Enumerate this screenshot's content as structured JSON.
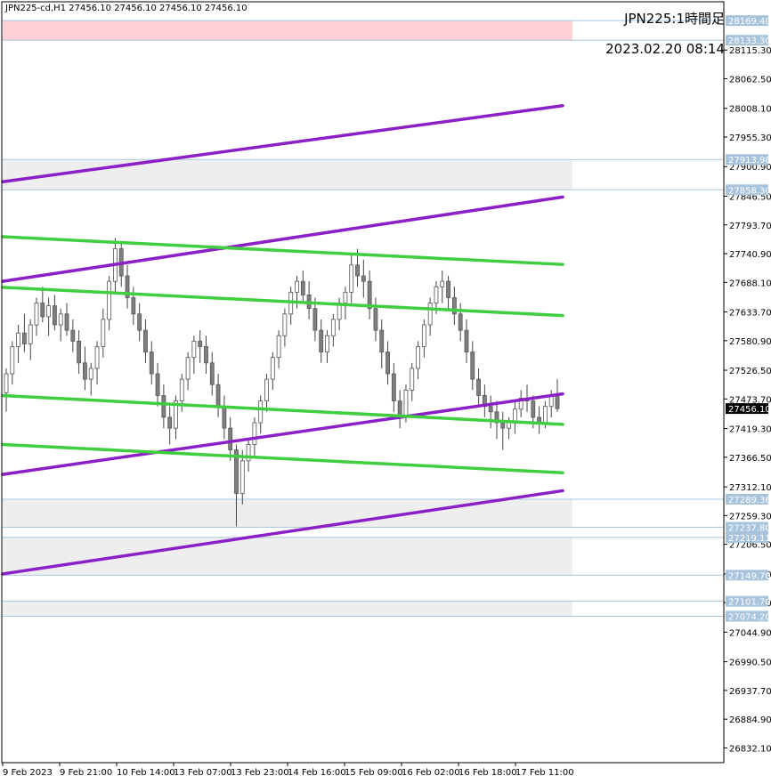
{
  "header": {
    "ohlc": "JPN225-cd,H1  27456.10 27456.10 27456.10 27456.10",
    "title": "JPN225:1時間足",
    "datetime": "2023.02.20 08:14"
  },
  "colors": {
    "purple": "#8b1fc8",
    "green": "#3fce3f",
    "zone_pink": "#ffd0d8",
    "zone_gray": "#eeeeee",
    "level_line": "#a8c8e0",
    "tag_bg": "#a8c3dc",
    "price_tag_bg": "#000000",
    "candle_up": "#ffffff",
    "candle_down": "#7f7f7f",
    "axis": "#000000"
  },
  "chart_data": {
    "type": "candlestick",
    "symbol": "JPN225-cd",
    "timeframe": "H1",
    "current_price": 27456.1,
    "current_price_label": "27456.10",
    "ylim": [
      26805,
      28204
    ],
    "y_ticks": [
      "28115.30",
      "28062.50",
      "28008.10",
      "27955.30",
      "27900.90",
      "27846.50",
      "27793.70",
      "27740.90",
      "27688.10",
      "27633.70",
      "27580.90",
      "27526.50",
      "27473.70",
      "27419.30",
      "27366.50",
      "27312.10",
      "27259.30",
      "27206.50",
      "27152.10",
      "27099.30",
      "27044.90",
      "26990.50",
      "26937.70",
      "26884.90",
      "26832.10"
    ],
    "x_labels": [
      "9 Feb 2023",
      "9 Feb 21:00",
      "10 Feb 14:00",
      "13 Feb 07:00",
      "13 Feb 23:00",
      "14 Feb 16:00",
      "15 Feb 09:00",
      "16 Feb 02:00",
      "16 Feb 18:00",
      "17 Feb 11:00"
    ],
    "levels": [
      {
        "label": "28169.40",
        "price": 28169.4
      },
      {
        "label": "28133.30",
        "price": 28133.3
      },
      {
        "label": "27913.98",
        "price": 27913.98
      },
      {
        "label": "27858.30",
        "price": 27858.3
      },
      {
        "label": "27289.36",
        "price": 27289.36
      },
      {
        "label": "27237.80",
        "price": 27237.8
      },
      {
        "label": "27219.11",
        "price": 27219.11
      },
      {
        "label": "27149.70",
        "price": 27149.7
      },
      {
        "label": "27101.70",
        "price": 27101.7
      },
      {
        "label": "27074.20",
        "price": 27074.2
      }
    ],
    "zones": [
      {
        "kind": "resistance",
        "from": 28133.3,
        "to": 28169.4
      },
      {
        "kind": "range",
        "from": 27858.3,
        "to": 27913.98
      },
      {
        "kind": "range",
        "from": 27237.8,
        "to": 27289.36
      },
      {
        "kind": "range",
        "from": 27149.7,
        "to": 27219.11
      },
      {
        "kind": "range",
        "from": 27074.2,
        "to": 27101.7
      }
    ],
    "trendlines": [
      {
        "color": "purple",
        "x": [
          0,
          1
        ],
        "y": [
          27873,
          28013
        ]
      },
      {
        "color": "purple",
        "x": [
          0,
          1
        ],
        "y": [
          27690,
          27845
        ]
      },
      {
        "color": "purple",
        "x": [
          0,
          1
        ],
        "y": [
          27335,
          27483
        ]
      },
      {
        "color": "purple",
        "x": [
          0,
          1
        ],
        "y": [
          27152,
          27305
        ]
      },
      {
        "color": "green",
        "x": [
          0,
          1
        ],
        "y": [
          27772,
          27721
        ]
      },
      {
        "color": "green",
        "x": [
          0,
          1
        ],
        "y": [
          27679,
          27627
        ]
      },
      {
        "color": "green",
        "x": [
          0,
          1
        ],
        "y": [
          27480,
          27427
        ]
      },
      {
        "color": "green",
        "x": [
          0,
          1
        ],
        "y": [
          27390,
          27338
        ]
      }
    ],
    "candles_ohlc": [
      [
        27485,
        27530,
        27450,
        27520
      ],
      [
        27520,
        27580,
        27500,
        27570
      ],
      [
        27570,
        27610,
        27540,
        27595
      ],
      [
        27595,
        27630,
        27560,
        27575
      ],
      [
        27575,
        27620,
        27545,
        27610
      ],
      [
        27610,
        27660,
        27590,
        27650
      ],
      [
        27650,
        27680,
        27615,
        27625
      ],
      [
        27625,
        27660,
        27590,
        27645
      ],
      [
        27645,
        27665,
        27600,
        27610
      ],
      [
        27610,
        27640,
        27580,
        27630
      ],
      [
        27630,
        27650,
        27590,
        27600
      ],
      [
        27600,
        27620,
        27560,
        27580
      ],
      [
        27580,
        27600,
        27520,
        27540
      ],
      [
        27540,
        27570,
        27490,
        27510
      ],
      [
        27510,
        27540,
        27480,
        27530
      ],
      [
        27530,
        27580,
        27500,
        27570
      ],
      [
        27570,
        27640,
        27550,
        27620
      ],
      [
        27620,
        27700,
        27600,
        27690
      ],
      [
        27690,
        27770,
        27670,
        27750
      ],
      [
        27750,
        27760,
        27680,
        27700
      ],
      [
        27700,
        27720,
        27640,
        27660
      ],
      [
        27660,
        27680,
        27610,
        27630
      ],
      [
        27630,
        27650,
        27580,
        27600
      ],
      [
        27600,
        27620,
        27540,
        27560
      ],
      [
        27560,
        27580,
        27500,
        27520
      ],
      [
        27520,
        27540,
        27460,
        27480
      ],
      [
        27480,
        27500,
        27420,
        27440
      ],
      [
        27440,
        27460,
        27390,
        27420
      ],
      [
        27420,
        27480,
        27400,
        27470
      ],
      [
        27470,
        27520,
        27450,
        27510
      ],
      [
        27510,
        27560,
        27490,
        27550
      ],
      [
        27550,
        27590,
        27520,
        27580
      ],
      [
        27580,
        27600,
        27540,
        27570
      ],
      [
        27570,
        27590,
        27520,
        27540
      ],
      [
        27540,
        27560,
        27480,
        27500
      ],
      [
        27500,
        27520,
        27440,
        27460
      ],
      [
        27460,
        27480,
        27400,
        27420
      ],
      [
        27420,
        27440,
        27360,
        27380
      ],
      [
        27380,
        27390,
        27240,
        27300
      ],
      [
        27300,
        27380,
        27280,
        27360
      ],
      [
        27360,
        27400,
        27340,
        27390
      ],
      [
        27390,
        27440,
        27370,
        27430
      ],
      [
        27430,
        27480,
        27410,
        27470
      ],
      [
        27470,
        27520,
        27450,
        27510
      ],
      [
        27510,
        27560,
        27490,
        27550
      ],
      [
        27550,
        27600,
        27530,
        27590
      ],
      [
        27590,
        27640,
        27570,
        27630
      ],
      [
        27630,
        27680,
        27610,
        27670
      ],
      [
        27670,
        27700,
        27640,
        27690
      ],
      [
        27690,
        27710,
        27650,
        27665
      ],
      [
        27665,
        27690,
        27620,
        27640
      ],
      [
        27640,
        27660,
        27580,
        27600
      ],
      [
        27600,
        27620,
        27540,
        27560
      ],
      [
        27560,
        27600,
        27540,
        27590
      ],
      [
        27590,
        27630,
        27570,
        27620
      ],
      [
        27620,
        27660,
        27600,
        27650
      ],
      [
        27650,
        27680,
        27620,
        27670
      ],
      [
        27670,
        27740,
        27650,
        27720
      ],
      [
        27720,
        27750,
        27680,
        27700
      ],
      [
        27700,
        27730,
        27660,
        27690
      ],
      [
        27690,
        27710,
        27620,
        27640
      ],
      [
        27640,
        27660,
        27580,
        27600
      ],
      [
        27600,
        27620,
        27530,
        27560
      ],
      [
        27560,
        27580,
        27500,
        27520
      ],
      [
        27520,
        27540,
        27450,
        27470
      ],
      [
        27470,
        27490,
        27420,
        27440
      ],
      [
        27440,
        27500,
        27430,
        27490
      ],
      [
        27490,
        27540,
        27470,
        27530
      ],
      [
        27530,
        27580,
        27510,
        27570
      ],
      [
        27570,
        27620,
        27550,
        27610
      ],
      [
        27610,
        27660,
        27590,
        27650
      ],
      [
        27650,
        27690,
        27630,
        27680
      ],
      [
        27680,
        27710,
        27650,
        27690
      ],
      [
        27690,
        27700,
        27640,
        27660
      ],
      [
        27660,
        27680,
        27610,
        27630
      ],
      [
        27630,
        27650,
        27580,
        27600
      ],
      [
        27600,
        27620,
        27540,
        27560
      ],
      [
        27560,
        27580,
        27490,
        27510
      ],
      [
        27510,
        27530,
        27460,
        27480
      ],
      [
        27480,
        27500,
        27440,
        27460
      ],
      [
        27460,
        27480,
        27420,
        27450
      ],
      [
        27450,
        27470,
        27400,
        27430
      ],
      [
        27430,
        27450,
        27380,
        27420
      ],
      [
        27420,
        27440,
        27400,
        27430
      ],
      [
        27430,
        27470,
        27410,
        27455
      ],
      [
        27455,
        27490,
        27440,
        27475
      ],
      [
        27475,
        27500,
        27450,
        27470
      ],
      [
        27470,
        27480,
        27420,
        27440
      ],
      [
        27440,
        27460,
        27410,
        27430
      ],
      [
        27430,
        27470,
        27420,
        27460
      ],
      [
        27460,
        27490,
        27440,
        27480
      ],
      [
        27480,
        27510,
        27450,
        27456
      ]
    ]
  }
}
